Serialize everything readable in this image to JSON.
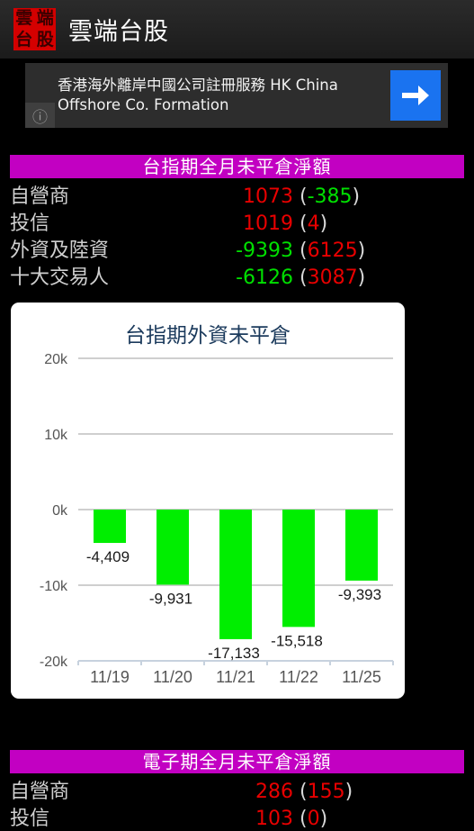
{
  "app": {
    "title": "雲端台股",
    "logo_chars": [
      "雲",
      "端",
      "台",
      "股"
    ],
    "logo_color": "#d40000"
  },
  "ad": {
    "text": "香港海外離岸中國公司註冊服務 HK China Offshore Co. Formation",
    "info_glyph": "ⓘ",
    "cta_color": "#1a73f0"
  },
  "colors": {
    "header_bar": "#c200c2",
    "positive": "#e80000",
    "negative": "#00e000",
    "bar": "#00ee00",
    "chart_title": "#1b3a5c"
  },
  "sections": [
    {
      "title": "台指期全月未平倉淨額",
      "rows": [
        {
          "label": "自營商",
          "value": "1073",
          "value_dir": "up",
          "change": "-385",
          "change_dir": "down"
        },
        {
          "label": "投信",
          "value": "1019",
          "value_dir": "up",
          "change": "4",
          "change_dir": "up"
        },
        {
          "label": "外資及陸資",
          "value": "-9393",
          "value_dir": "down",
          "change": "6125",
          "change_dir": "up"
        },
        {
          "label": "十大交易人",
          "value": "-6126",
          "value_dir": "down",
          "change": "3087",
          "change_dir": "up"
        }
      ]
    },
    {
      "title": "電子期全月未平倉淨額",
      "rows": [
        {
          "label": "自營商",
          "value": "286",
          "value_dir": "up",
          "change": "155",
          "change_dir": "up"
        },
        {
          "label": "投信",
          "value": "103",
          "value_dir": "up",
          "change": "0",
          "change_dir": "up"
        }
      ]
    }
  ],
  "chart_data": {
    "type": "bar",
    "title": "台指期外資未平倉",
    "categories": [
      "11/19",
      "11/20",
      "11/21",
      "11/22",
      "11/25"
    ],
    "values": [
      -4409,
      -9931,
      -17133,
      -15518,
      -9393
    ],
    "value_labels": [
      "-4,409",
      "-9,931",
      "-17,133",
      "-15,518",
      "-9,393"
    ],
    "ytick_labels": [
      "20k",
      "10k",
      "0k",
      "-10k",
      "-20k"
    ],
    "ytick_values": [
      20000,
      10000,
      0,
      -10000,
      -20000
    ],
    "ylim": [
      -20000,
      20000
    ],
    "xlabel": "",
    "ylabel": "",
    "grid": true,
    "legend": "none",
    "bar_color": "#00ee00"
  }
}
